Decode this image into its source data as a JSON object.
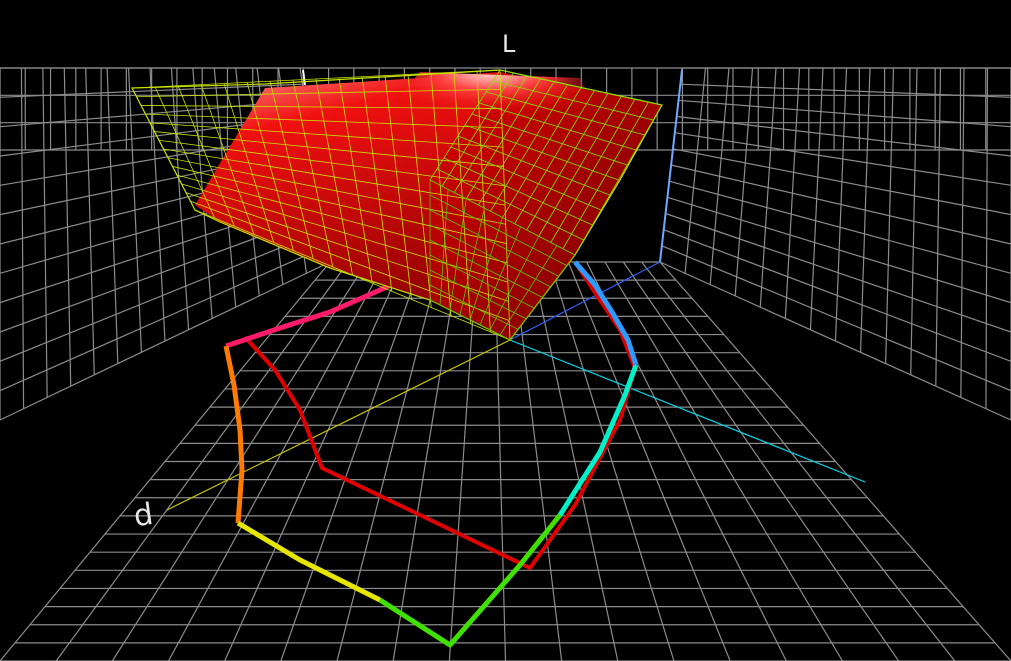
{
  "view": {
    "background": "#000000",
    "grid_color": "#8c8c8c",
    "axis_labels": {
      "vertical": "L",
      "horizontal": "d"
    }
  },
  "gamut_solid": {
    "fill": "#e00000",
    "wireframe_color": "#c8e000"
  },
  "gamut_outlines": {
    "primary": "rainbow",
    "secondary": "#e00000"
  },
  "axes": {
    "vertical_color": "#6fa8ff",
    "left_color": "#d7d700",
    "right_color": "#00e0f0"
  }
}
